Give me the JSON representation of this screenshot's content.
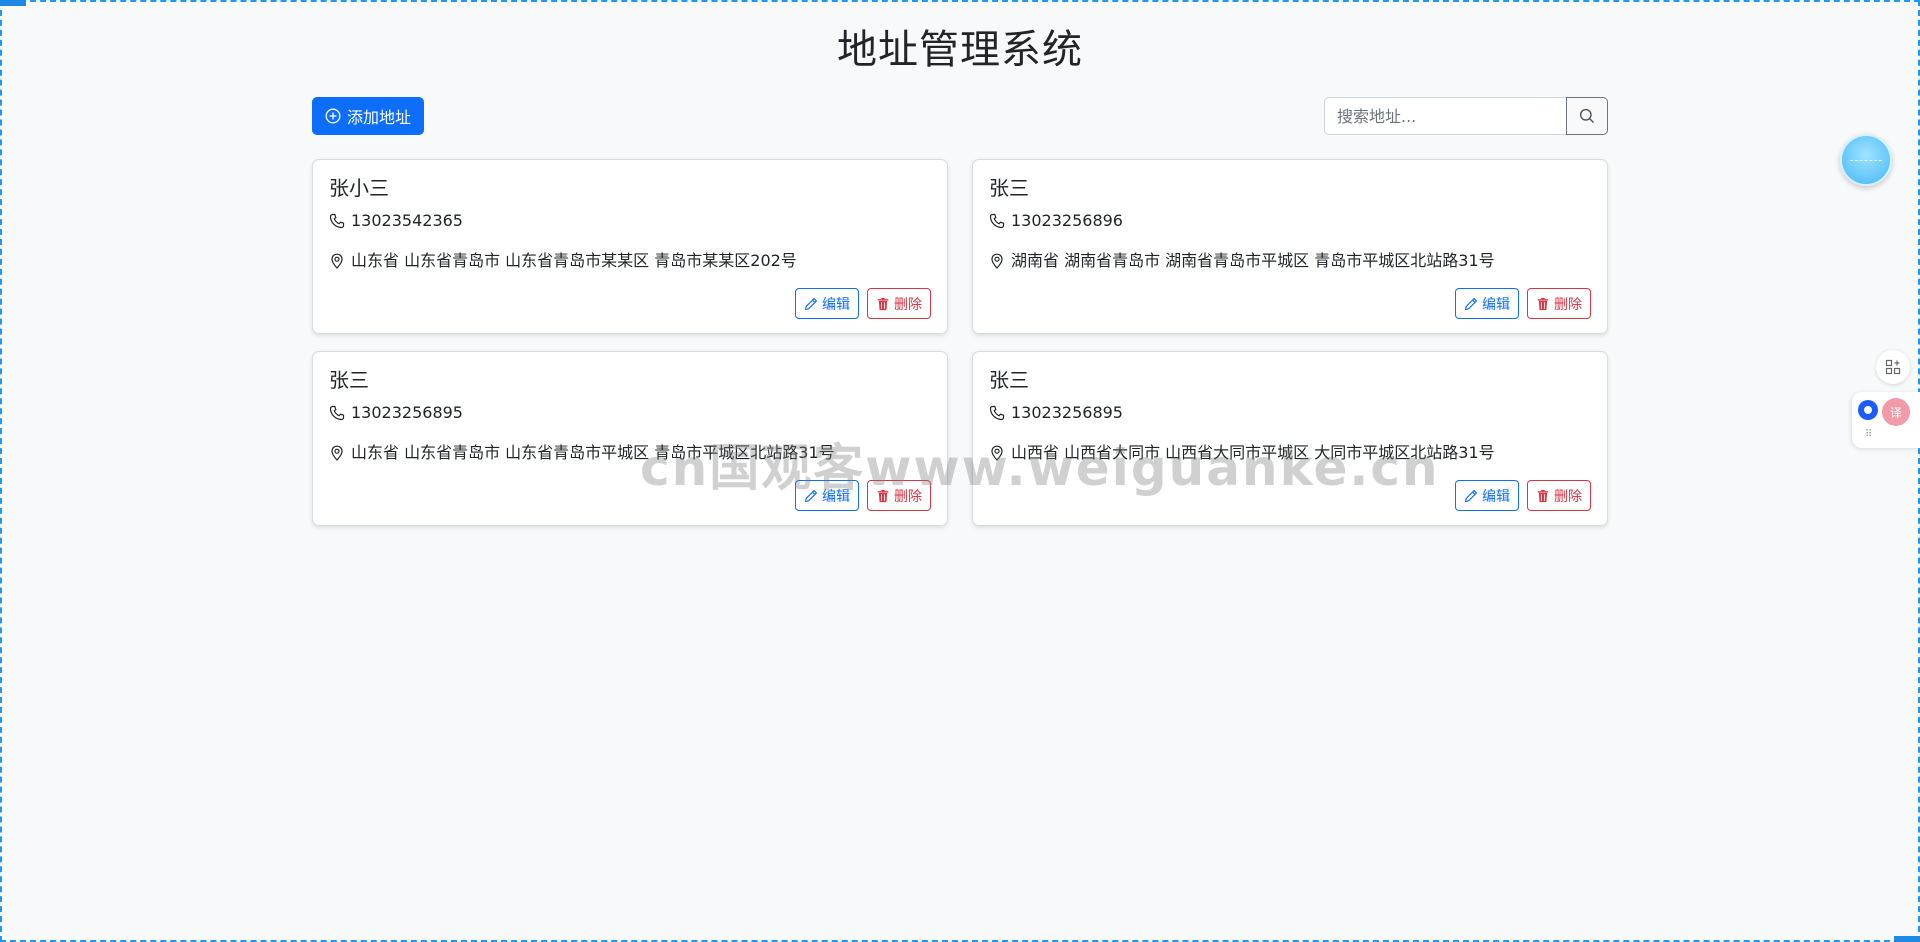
{
  "page": {
    "title": "地址管理系统"
  },
  "toolbar": {
    "add_label": "添加地址",
    "search_placeholder": "搜索地址..."
  },
  "addresses": [
    {
      "name": "张小三",
      "phone": "13023542365",
      "address": "山东省 山东省青岛市 山东省青岛市某某区 青岛市某某区202号",
      "edit_label": "编辑",
      "delete_label": "删除"
    },
    {
      "name": "张三",
      "phone": "13023256896",
      "address": "湖南省 湖南省青岛市 湖南省青岛市平城区 青岛市平城区北站路31号",
      "edit_label": "编辑",
      "delete_label": "删除"
    },
    {
      "name": "张三",
      "phone": "13023256895",
      "address": "山东省 山东省青岛市 山东省青岛市平城区 青岛市平城区北站路31号",
      "edit_label": "编辑",
      "delete_label": "删除"
    },
    {
      "name": "张三",
      "phone": "13023256895",
      "address": "山西省 山西省大同市 山西省大同市平城区 大同市平城区北站路31号",
      "edit_label": "编辑",
      "delete_label": "删除"
    }
  ],
  "watermark": {
    "text": "cn国观客www.weiguanke.cn"
  },
  "floating": {
    "translate_label": "译"
  },
  "colors": {
    "primary": "#0d6efd",
    "danger": "#dc3545",
    "background": "#f8f9fa"
  },
  "icons": {
    "add": "plus-circle-icon",
    "search": "search-icon",
    "phone": "telephone-icon",
    "location": "geo-pin-icon",
    "edit": "pencil-icon",
    "delete": "trash-icon"
  }
}
